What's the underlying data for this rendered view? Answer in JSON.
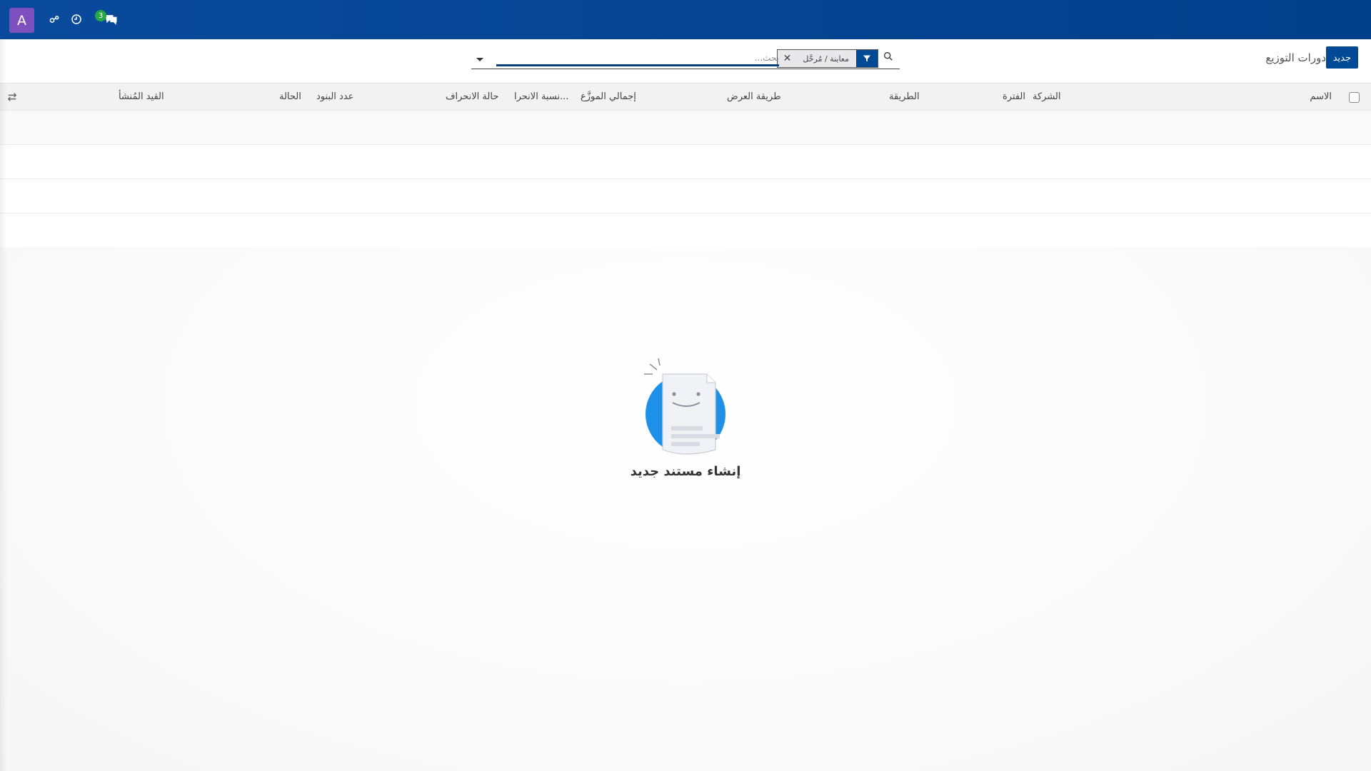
{
  "navbar": {
    "avatar_letter": "A",
    "chat_badge_count": "3",
    "icons": [
      "settings-share-icon",
      "clock-icon",
      "chat-icon"
    ],
    "background_color": "#0a4a9c"
  },
  "control_panel": {
    "new_button_label": "جديد",
    "page_title": "دورات التوزيع",
    "search": {
      "placeholder": "بحث...",
      "facet_label": "معاينة / مُرحَّل",
      "facet_close": "✕"
    }
  },
  "table": {
    "columns": [
      "الاسم",
      "الفترة",
      "الشركة",
      "الطريقة",
      "طريقة العرض",
      "إجمالي الموزَّع",
      "نسبة الانحرا...",
      "حالة الانحراف",
      "عدد البنود",
      "الحالة",
      "القيد المُنشأ"
    ]
  },
  "empty_state": {
    "title": "إنشاء مستند جديد"
  },
  "colors": {
    "primary": "#004a95",
    "avatar": "#7d4fbf",
    "badge": "#28a745",
    "header_bg": "#f2f2f2"
  }
}
